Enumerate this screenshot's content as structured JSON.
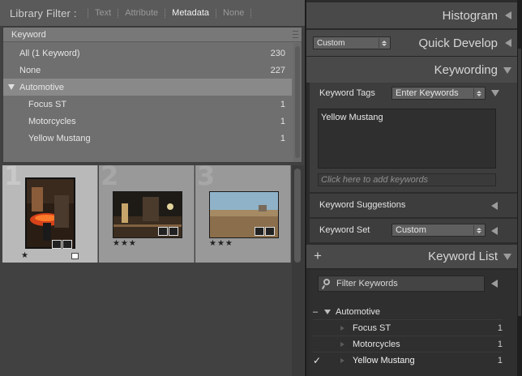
{
  "library_filter": {
    "title": "Library Filter :",
    "options": [
      {
        "label": "Text",
        "active": false
      },
      {
        "label": "Attribute",
        "active": false
      },
      {
        "label": "Metadata",
        "active": true
      },
      {
        "label": "None",
        "active": false
      }
    ]
  },
  "keyword_column": {
    "header": "Keyword",
    "rows": [
      {
        "label": "All (1 Keyword)",
        "count": "230"
      },
      {
        "label": "None",
        "count": "227"
      },
      {
        "label": "Automotive",
        "count": "",
        "expanded": true,
        "selected": true
      },
      {
        "label": "Focus ST",
        "count": "1"
      },
      {
        "label": "Motorcycles",
        "count": "1"
      },
      {
        "label": "Yellow Mustang",
        "count": "1"
      }
    ]
  },
  "grid": {
    "cells": [
      {
        "index": "1",
        "stars": "★",
        "selected": true
      },
      {
        "index": "2",
        "stars": "★★★",
        "selected": false
      },
      {
        "index": "3",
        "stars": "★★★",
        "selected": false
      }
    ]
  },
  "right_panel": {
    "histogram": "Histogram",
    "quick_develop": {
      "title": "Quick Develop",
      "preset": "Custom"
    },
    "keywording": {
      "title": "Keywording",
      "tags_label": "Keyword Tags",
      "tags_mode": "Enter Keywords",
      "keywords_text": "Yellow Mustang",
      "add_placeholder": "Click here to add keywords",
      "suggestions_label": "Keyword Suggestions",
      "set_label": "Keyword Set",
      "set_value": "Custom"
    },
    "keyword_list": {
      "add_symbol": "+",
      "title": "Keyword List",
      "filter_placeholder": "Filter Keywords",
      "items": [
        {
          "mark": "–",
          "label": "Automotive",
          "count": "",
          "level": 0
        },
        {
          "mark": "",
          "label": "Focus ST",
          "count": "1",
          "level": 1
        },
        {
          "mark": "",
          "label": "Motorcycles",
          "count": "1",
          "level": 1
        },
        {
          "mark": "✓",
          "label": "Yellow Mustang",
          "count": "1",
          "level": 1
        }
      ]
    }
  },
  "colors": {
    "panel_bg": "#2c2c2c",
    "header_bg": "#494949",
    "filter_panel_bg": "#6f6f6f",
    "selected_cell": "#b9b9b9",
    "grid_cell": "#999999"
  },
  "icons": [
    "grip-icon",
    "disclosure-triangle-icon",
    "keyword-badge-icon",
    "caption-badge-icon",
    "search-icon",
    "checkmark-icon",
    "plus-icon"
  ]
}
